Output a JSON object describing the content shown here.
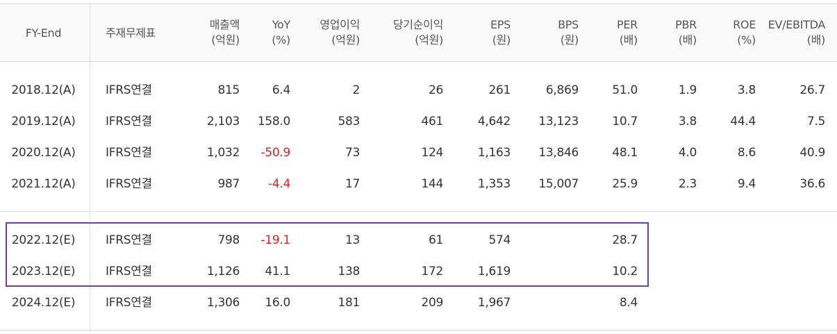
{
  "header": {
    "fy_end": "FY-End",
    "main_statement": "주재무제표",
    "sales": {
      "l1": "매출액",
      "l2": "(억원)"
    },
    "yoy": {
      "l1": "YoY",
      "l2": "(%)"
    },
    "op_income": {
      "l1": "영업이익",
      "l2": "(억원)"
    },
    "net_income": {
      "l1": "당기순이익",
      "l2": "(억원)"
    },
    "eps": {
      "l1": "EPS",
      "l2": "(원)"
    },
    "bps": {
      "l1": "BPS",
      "l2": "(원)"
    },
    "per": {
      "l1": "PER",
      "l2": "(배)"
    },
    "pbr": {
      "l1": "PBR",
      "l2": "(배)"
    },
    "roe": {
      "l1": "ROE",
      "l2": "(%)"
    },
    "ev_ebitda": {
      "l1": "EV/EBITDA",
      "l2": "(배)"
    }
  },
  "rows": [
    {
      "fy": "2018.12(A)",
      "stmt": "IFRS연결",
      "sales": "815",
      "yoy": "6.4",
      "op": "2",
      "net": "26",
      "eps": "261",
      "bps": "6,869",
      "per": "51.0",
      "pbr": "1.9",
      "roe": "3.8",
      "ev": "26.7"
    },
    {
      "fy": "2019.12(A)",
      "stmt": "IFRS연결",
      "sales": "2,103",
      "yoy": "158.0",
      "op": "583",
      "net": "461",
      "eps": "4,642",
      "bps": "13,123",
      "per": "10.7",
      "pbr": "3.8",
      "roe": "44.4",
      "ev": "7.5"
    },
    {
      "fy": "2020.12(A)",
      "stmt": "IFRS연결",
      "sales": "1,032",
      "yoy": "-50.9",
      "op": "73",
      "net": "124",
      "eps": "1,163",
      "bps": "13,846",
      "per": "48.1",
      "pbr": "4.0",
      "roe": "8.6",
      "ev": "40.9"
    },
    {
      "fy": "2021.12(A)",
      "stmt": "IFRS연결",
      "sales": "987",
      "yoy": "-4.4",
      "op": "17",
      "net": "144",
      "eps": "1,353",
      "bps": "15,007",
      "per": "25.9",
      "pbr": "2.3",
      "roe": "9.4",
      "ev": "36.6"
    },
    {
      "fy": "2022.12(E)",
      "stmt": "IFRS연결",
      "sales": "798",
      "yoy": "-19.1",
      "op": "13",
      "net": "61",
      "eps": "574",
      "bps": "",
      "per": "28.7",
      "pbr": "",
      "roe": "",
      "ev": ""
    },
    {
      "fy": "2023.12(E)",
      "stmt": "IFRS연결",
      "sales": "1,126",
      "yoy": "41.1",
      "op": "138",
      "net": "172",
      "eps": "1,619",
      "bps": "",
      "per": "10.2",
      "pbr": "",
      "roe": "",
      "ev": ""
    },
    {
      "fy": "2024.12(E)",
      "stmt": "IFRS연결",
      "sales": "1,306",
      "yoy": "16.0",
      "op": "181",
      "net": "209",
      "eps": "1,967",
      "bps": "",
      "per": "8.4",
      "pbr": "",
      "roe": "",
      "ev": ""
    }
  ],
  "colors": {
    "negative": "#e02020",
    "highlight_border": "#6b3fa0"
  }
}
